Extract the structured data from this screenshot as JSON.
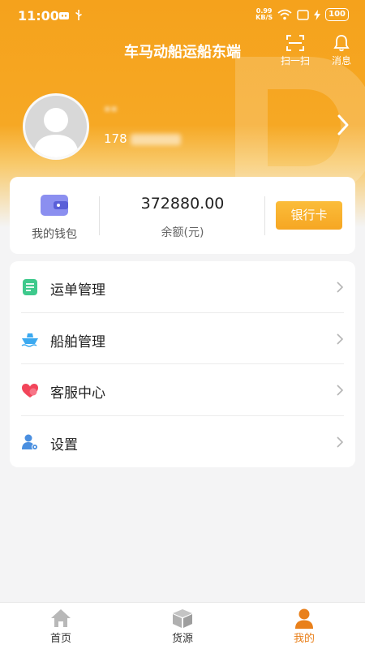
{
  "status_bar": {
    "time": "11:00",
    "net_speed_value": "0.99",
    "net_speed_unit": "KB/S",
    "battery": "100"
  },
  "header": {
    "title": "车马动船运船东端",
    "scan_label": "扫一扫",
    "message_label": "消息"
  },
  "profile": {
    "name": "**",
    "phone_prefix": "178"
  },
  "wallet": {
    "label": "我的钱包",
    "balance": "372880.00",
    "balance_label": "余额(元)",
    "bank_card_button": "银行卡"
  },
  "menu": {
    "items": [
      {
        "label": "运单管理",
        "icon": "waybill-icon"
      },
      {
        "label": "船舶管理",
        "icon": "ship-icon"
      },
      {
        "label": "客服中心",
        "icon": "customer-service-icon"
      },
      {
        "label": "设置",
        "icon": "settings-user-icon"
      }
    ]
  },
  "tabs": [
    {
      "label": "首页",
      "icon": "home-icon",
      "active": false
    },
    {
      "label": "货源",
      "icon": "cargo-box-icon",
      "active": false
    },
    {
      "label": "我的",
      "icon": "person-icon",
      "active": true
    }
  ],
  "colors": {
    "brand_orange": "#f5a21c",
    "button_orange": "#f6a623",
    "active_tab": "#e9801b"
  }
}
